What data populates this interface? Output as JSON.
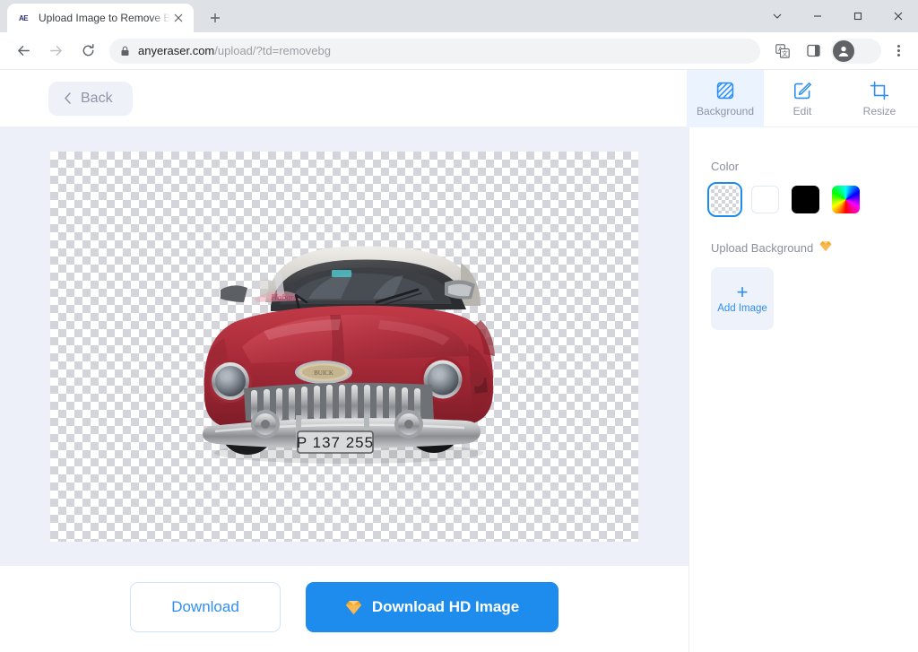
{
  "browser": {
    "tab": {
      "favicon": "ae-logo-icon",
      "title": "Upload Image to Remove Bg",
      "close": "✕"
    },
    "new_tab": "+",
    "window_controls": {
      "minimize_group": "⌄",
      "minimize": "–",
      "maximize": "□",
      "close": "✕"
    },
    "nav": {
      "back": "←",
      "forward": "→",
      "reload": "↻"
    },
    "omnibox": {
      "host": "anyeraser.com",
      "path": "/upload/?td=removebg",
      "lock": "lock-icon"
    },
    "toolbar_icons": {
      "translate": "translate-icon",
      "side_panel": "side-panel-icon",
      "profile": "profile-avatar-icon",
      "menu": "three-dot-menu-icon"
    }
  },
  "app": {
    "back_button": {
      "label": "Back",
      "chevron": "‹"
    },
    "mode_tabs": [
      {
        "id": "background",
        "label": "Background",
        "icon": "background-stripes-icon",
        "active": true
      },
      {
        "id": "edit",
        "label": "Edit",
        "icon": "pencil-square-icon",
        "active": false
      },
      {
        "id": "resize",
        "label": "Resize",
        "icon": "crop-icon",
        "active": false
      }
    ],
    "canvas": {
      "background_mode": "transparent-checkerboard",
      "image_subject": "vintage red car with white roof",
      "license_plate": "P 137 255"
    },
    "panel": {
      "color_label": "Color",
      "swatches": [
        {
          "id": "transparent",
          "name": "transparent-swatch",
          "selected": true
        },
        {
          "id": "white",
          "name": "white-swatch",
          "hex": "#ffffff",
          "selected": false
        },
        {
          "id": "black",
          "name": "black-swatch",
          "hex": "#000000",
          "selected": false
        },
        {
          "id": "custom",
          "name": "color-picker-swatch",
          "selected": false
        }
      ],
      "upload_label": "Upload Background",
      "upload_premium_icon": "💎",
      "add_image": {
        "label": "Add Image",
        "plus": "+"
      }
    },
    "actions": {
      "download": "Download",
      "download_hd": "Download HD Image",
      "download_hd_icon": "💎"
    }
  }
}
